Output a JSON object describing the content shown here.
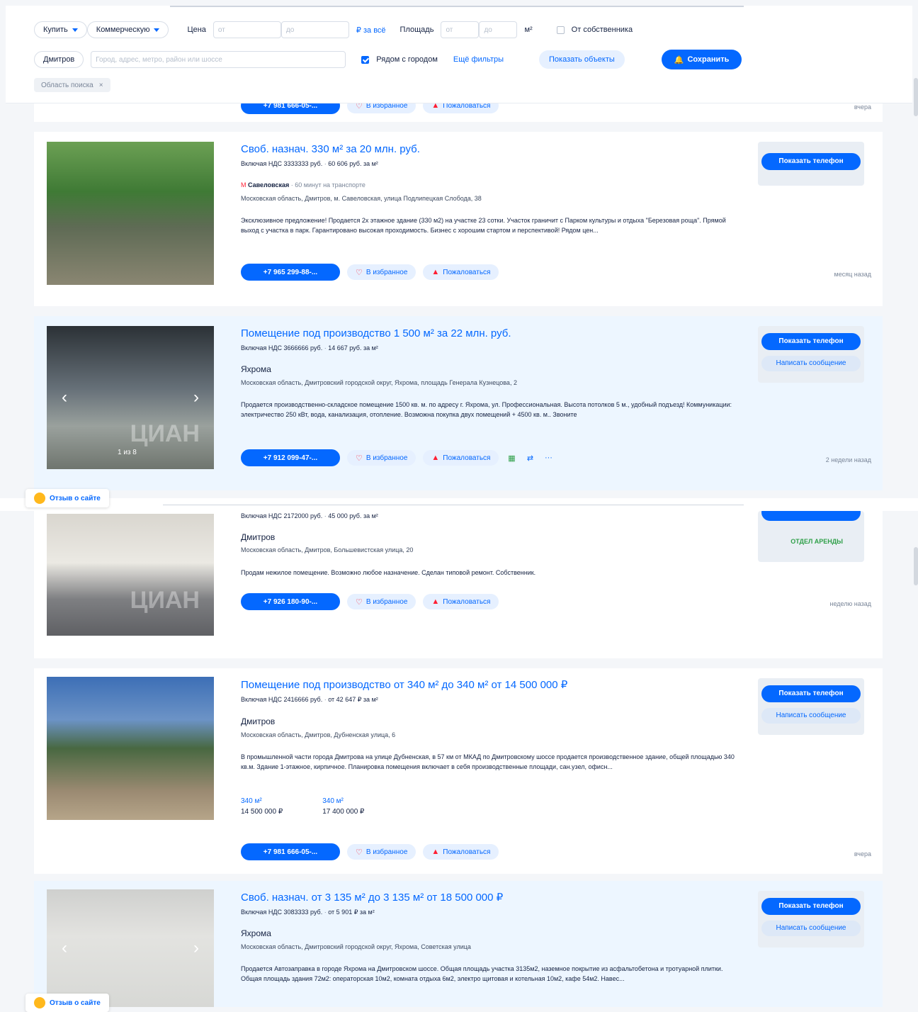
{
  "filters": {
    "deal": "Купить",
    "type": "Коммерческую",
    "price_label": "Цена",
    "price_from": "от",
    "price_to": "до",
    "price_unit": "₽ за всё",
    "area_label": "Площадь",
    "area_from": "от",
    "area_to": "до",
    "area_unit": "м²",
    "owner_label": "От собственника",
    "city": "Дмитров",
    "search_placeholder": "Город, адрес, метро, район или шоссе",
    "near_city_label": "Рядом с городом",
    "more_filters": "Ещё фильтры",
    "show_objects": "Показать объекты",
    "save": "Сохранить",
    "tag": "Область поиска"
  },
  "prev_card": {
    "phone": "+7 981 666-05-...",
    "fav": "В избранное",
    "report": "Пожаловаться",
    "date": "вчера"
  },
  "listings": [
    {
      "title": "Своб. назнач. 330 м² за 20 млн. руб.",
      "sub": "Включая НДС 3333333 руб.",
      "sub2": "60 606 руб. за м²",
      "metro": "Савеловская",
      "metro_time": "· 60 минут на транспорте",
      "address": "Московская область, Дмитров, м. Савеловская, улица Подлипецкая Слобода, 38",
      "desc": "Эксклюзивное предложение! Продается 2х этажное здание (330 м2) на участке 23 сотки. Участок граничит с Парком культуры и отдыха \"Березовая роща\". Прямой выход с участка в парк. Гарантировано высокая проходимость. Бизнес с хорошим стартом и перспективой! Рядом цен...",
      "phone": "+7 965 299-88-...",
      "fav": "В избранное",
      "report": "Пожаловаться",
      "date": "месяц назад",
      "show_phone": "Показать телефон"
    },
    {
      "title": "Помещение под производство 1 500 м² за 22 млн. руб.",
      "sub": "Включая НДС 3666666 руб.",
      "sub2": "14 667 руб. за м²",
      "location": "Яхрома",
      "address": "Московская область, Дмитровский городской округ, Яхрома, площадь Генерала Кузнецова, 2",
      "desc": "Продается производственно-складское помещение 1500 кв. м. по адресу г. Яхрома, ул. Профессиональная. Высота потолков 5 м., удобный подъезд! Коммуникации: электричество 250 кВт, вода, канализация, отопление. Возможна покупка двух помещений + 4500 кв. м.. Звоните",
      "phone": "+7 912 099-47-...",
      "fav": "В избранное",
      "report": "Пожаловаться",
      "date": "2 недели назад",
      "show_phone": "Показать телефон",
      "write": "Написать сообщение",
      "photo_count": "1 из 8"
    },
    {
      "sub": "Включая НДС 2172000 руб.",
      "sub2": "45 000 руб. за м²",
      "location": "Дмитров",
      "address": "Московская область, Дмитров, Большевистская улица, 20",
      "desc": "Продам нежилое помещение. Возможно любое назначение. Сделан типовой ремонт. Собственник.",
      "phone": "+7 926 180-90-...",
      "fav": "В избранное",
      "report": "Пожаловаться",
      "date": "неделю назад",
      "agency": "ОТДЕЛ АРЕНДЫ"
    },
    {
      "title": "Помещение под производство от 340 м² до 340 м² от 14 500 000 ₽",
      "sub": "Включая НДС 2416666 руб.",
      "sub2": "от 42 647 ₽ за м²",
      "location": "Дмитров",
      "address": "Московская область, Дмитров, Дубненская улица, 6",
      "desc": "В промышленной части города Дмитрова на улице Дубненская, в 57 км от МКАД по Дмитровскому шоссе продается производственное здание, общей площадью 340 кв.м. Здание 1-этажное, кирпичное. Планировка помещения включает в себя производственные площади, сан.узел, офисн...",
      "price1_area": "340 м²",
      "price1": "14 500 000 ₽",
      "price2_area": "340 м²",
      "price2": "17 400 000 ₽",
      "phone": "+7 981 666-05-...",
      "fav": "В избранное",
      "report": "Пожаловаться",
      "date": "вчера",
      "show_phone": "Показать телефон",
      "write": "Написать сообщение"
    },
    {
      "title": "Своб. назнач. от 3 135 м² до 3 135 м² от 18 500 000 ₽",
      "sub": "Включая НДС 3083333 руб.",
      "sub2": "от 5 901 ₽ за м²",
      "location": "Яхрома",
      "address": "Московская область, Дмитровский городской округ, Яхрома, Советская улица",
      "desc": "Продается Автозаправка в городе Яхрома на Дмитровском шоссе. Общая площадь участка 3135м2, наземное покрытие из асфальтобетона и тротуарной плитки. Общая площадь здания 72м2: операторская 10м2, комната отдыха 6м2, электро щитовая и котельная 10м2, кафе 54м2. Навес...",
      "show_phone": "Показать телефон",
      "write": "Написать сообщение"
    }
  ],
  "feedback": "Отзыв о сайте"
}
